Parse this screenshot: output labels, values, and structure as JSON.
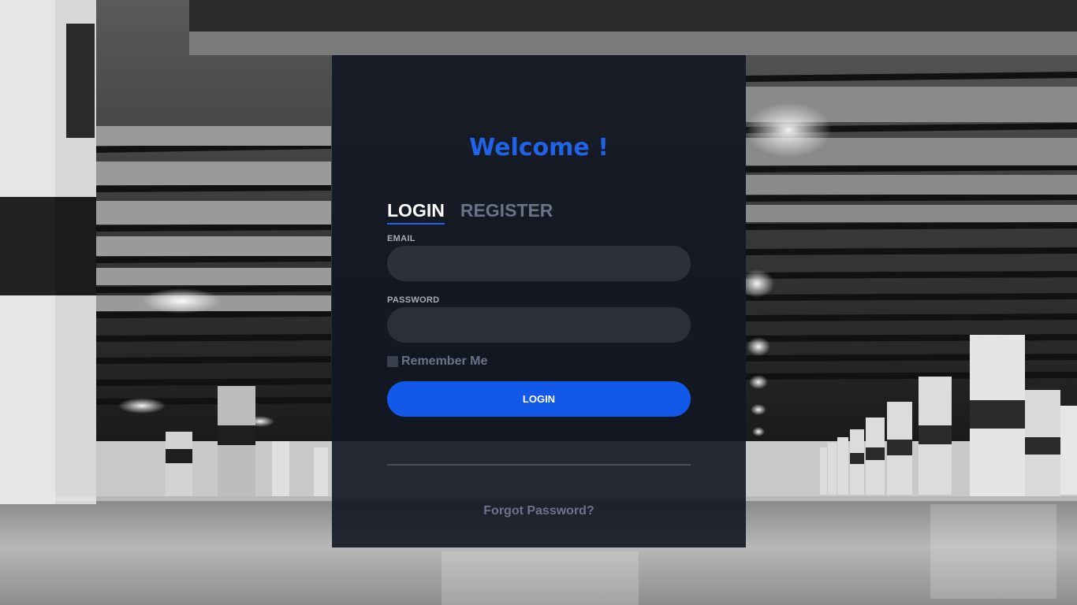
{
  "login_card": {
    "welcome": "Welcome !",
    "tabs": [
      {
        "label": "LOGIN",
        "active": true
      },
      {
        "label": "REGISTER",
        "active": false
      }
    ],
    "email": {
      "label": "EMAIL",
      "value": "",
      "placeholder": ""
    },
    "password": {
      "label": "PASSWORD",
      "value": "",
      "placeholder": ""
    },
    "remember_me": {
      "label": "Remember Me",
      "checked": false
    },
    "submit_label": "LOGIN",
    "forgot_password": "Forgot Password?"
  },
  "colors": {
    "accent": "#1259e9",
    "title": "#1f63e8",
    "card_bg": "#121621",
    "muted_text": "#6b7187"
  },
  "icons": []
}
